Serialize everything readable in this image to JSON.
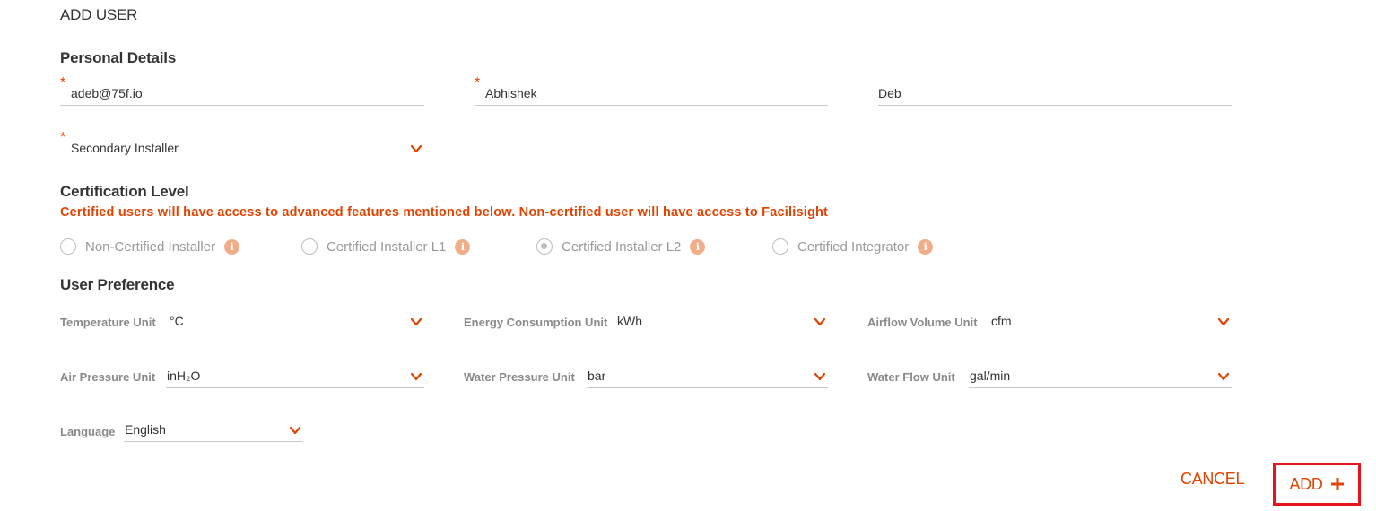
{
  "page": {
    "title": "ADD USER"
  },
  "personal": {
    "heading": "Personal Details",
    "email": "adeb@75f.io",
    "first_name": "Abhishek",
    "last_name": "Deb",
    "role": "Secondary Installer",
    "required_mark": "*"
  },
  "certification": {
    "heading": "Certification Level",
    "note": "Certified users will have access to advanced features mentioned below. Non-certified user will have access to Facilisight",
    "options": [
      {
        "label": "Non-Certified Installer",
        "selected": false
      },
      {
        "label": "Certified Installer L1",
        "selected": false
      },
      {
        "label": "Certified Installer L2",
        "selected": true
      },
      {
        "label": "Certified Integrator",
        "selected": false
      }
    ],
    "info_glyph": "i"
  },
  "preference": {
    "heading": "User Preference",
    "temperature": {
      "label": "Temperature Unit",
      "value": "°C"
    },
    "energy": {
      "label": "Energy Consumption Unit",
      "value": "kWh"
    },
    "airflow": {
      "label": "Airflow Volume Unit",
      "value": "cfm"
    },
    "air_pressure": {
      "label": "Air Pressure Unit",
      "value": "inH₂O"
    },
    "water_pressure": {
      "label": "Water Pressure Unit",
      "value": "bar"
    },
    "water_flow": {
      "label": "Water Flow Unit",
      "value": "gal/min"
    },
    "language": {
      "label": "Language",
      "value": "English"
    }
  },
  "actions": {
    "cancel": "CANCEL",
    "add": "ADD"
  },
  "colors": {
    "accent": "#e24301",
    "highlight_border": "#e8121a",
    "muted": "#9a9a9a",
    "info": "#f0ad8a"
  },
  "icons": {
    "dropdown": "chevron-down-icon",
    "info": "info-icon",
    "add": "plus-icon"
  }
}
